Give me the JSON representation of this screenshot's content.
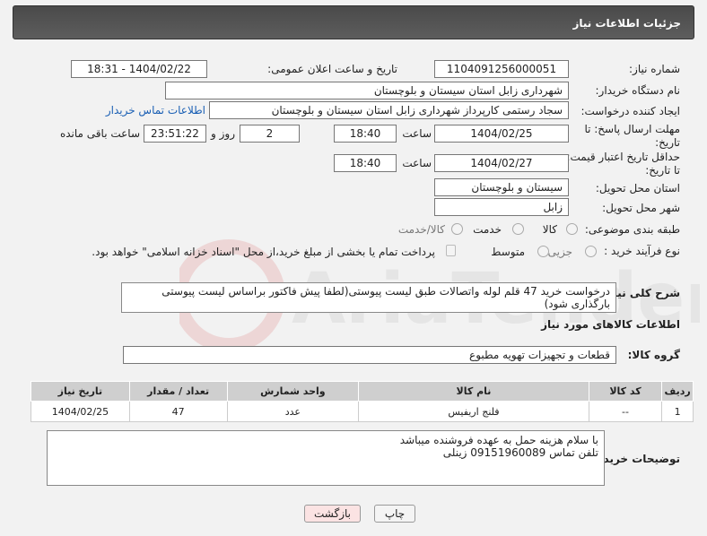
{
  "header": {
    "title": "جزئیات اطلاعات نیاز"
  },
  "need_number": {
    "label": "شماره نیاز:",
    "value": "1104091256000051"
  },
  "announce": {
    "label": "تاریخ و ساعت اعلان عمومی:",
    "value": "1404/02/22 - 18:31"
  },
  "buyer_org": {
    "label": "نام دستگاه خریدار:",
    "value": "شهرداری زابل استان سیستان و بلوچستان"
  },
  "creator": {
    "label": "ایجاد کننده درخواست:",
    "value": "سجاد رستمی کارپرداز شهرداری زابل استان سیستان و بلوچستان",
    "contact_link": "اطلاعات تماس خریدار"
  },
  "deadline": {
    "label_line1": "مهلت ارسال پاسخ: تا",
    "label_line2": "تاریخ:",
    "date": "1404/02/25",
    "time_label": "ساعت",
    "time": "18:40",
    "days": "2",
    "days_label": "روز و",
    "remaining": "23:51:22",
    "remaining_label": "ساعت باقی مانده"
  },
  "price_validity": {
    "label_line1": "حداقل تاریخ اعتبار قیمت:",
    "label_line2": "تا تاریخ:",
    "date": "1404/02/27",
    "time_label": "ساعت",
    "time": "18:40"
  },
  "province": {
    "label": "استان محل تحویل:",
    "value": "سیستان و بلوچستان"
  },
  "city": {
    "label": "شهر محل تحویل:",
    "value": "زابل"
  },
  "category": {
    "label": "طبقه بندی موضوعی:",
    "options": [
      "کالا",
      "خدمت",
      "کالا/خدمت"
    ]
  },
  "process": {
    "label": "نوع فرآیند خرید :",
    "options": [
      "جزیی",
      "متوسط"
    ],
    "note": "پرداخت تمام یا بخشی از مبلغ خرید،از محل \"اسناد خزانه اسلامی\" خواهد بود."
  },
  "description": {
    "label": "شرح کلی نیاز:",
    "text": "درخواست خرید 47 قلم لوله واتصالات  طبق لیست پیوستی(لطفا پیش فاکتور براساس لیست پیوستی بارگذاری شود)"
  },
  "goods_section": {
    "title": "اطلاعات کالاهای مورد نیاز"
  },
  "goods_group": {
    "label": "گروه کالا:",
    "value": "قطعات و تجهیزات تهویه مطبوع"
  },
  "table": {
    "headers": [
      "ردیف",
      "کد کالا",
      "نام کالا",
      "واحد شمارش",
      "تعداد / مقدار",
      "تاریخ نیاز"
    ],
    "rows": [
      [
        "1",
        "--",
        "فلنج اریفیس",
        "عدد",
        "47",
        "1404/02/25"
      ]
    ]
  },
  "buyer_notes": {
    "label": "توضیحات خریدار:",
    "line1": "با سلام  هزینه حمل به عهده فروشنده میباشد",
    "line2": "تلفن تماس 09151960089 زینلی"
  },
  "buttons": {
    "print": "چاپ",
    "back": "بازگشت"
  },
  "watermark": {
    "text": "AriaTender.net"
  }
}
